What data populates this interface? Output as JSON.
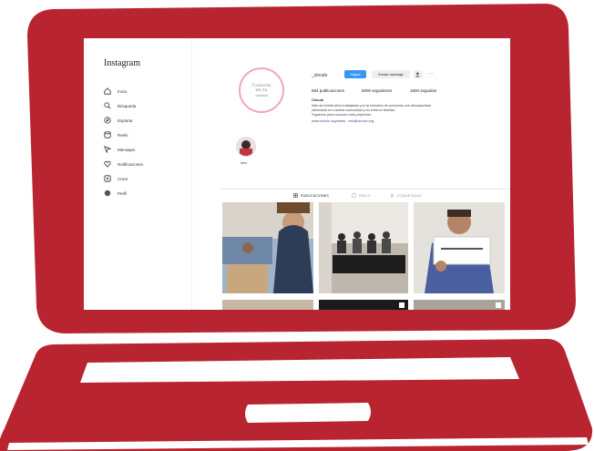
{
  "colors": {
    "frame": "#b82430",
    "follow": "#3897f0",
    "ring": "#f3a6b6"
  },
  "app": {
    "name": "Instagram"
  },
  "sidebar": {
    "items": [
      {
        "label": "Inicio",
        "icon": "home-icon"
      },
      {
        "label": "Búsqueda",
        "icon": "search-icon"
      },
      {
        "label": "Explorar",
        "icon": "explore-icon"
      },
      {
        "label": "Reels",
        "icon": "reels-icon"
      },
      {
        "label": "Mensajes",
        "icon": "messages-icon"
      },
      {
        "label": "Notificaciones",
        "icon": "heart-icon"
      },
      {
        "label": "Crear",
        "icon": "create-icon"
      },
      {
        "label": "Perfil",
        "icon": "profile-icon"
      }
    ]
  },
  "profile": {
    "avatar_text": [
      "Conecta",
      "en tu",
      "ciudad"
    ],
    "handle": "_circulo",
    "follow_label": "Seguir",
    "message_label": "Enviar mensaje",
    "stats": [
      "684 publicaciones",
      "5000 seguidores",
      "1600 seguidos"
    ],
    "bio": [
      "Círculo",
      "Más de treinta años trabajando por la inclusión de personas con discapacidad",
      "intelectual en nuestra comunidad y su entorno familiar.",
      "Síguenos para conocer más proyectos.",
      "www.circulo.org/redes · info@circulo.org"
    ],
    "highlight_label": "Info"
  },
  "tabs": [
    {
      "label": "PUBLICACIONES",
      "icon": "grid-icon"
    },
    {
      "label": "REELS",
      "icon": "reels-icon"
    },
    {
      "label": "ETIQUETADAS",
      "icon": "tag-icon"
    }
  ]
}
